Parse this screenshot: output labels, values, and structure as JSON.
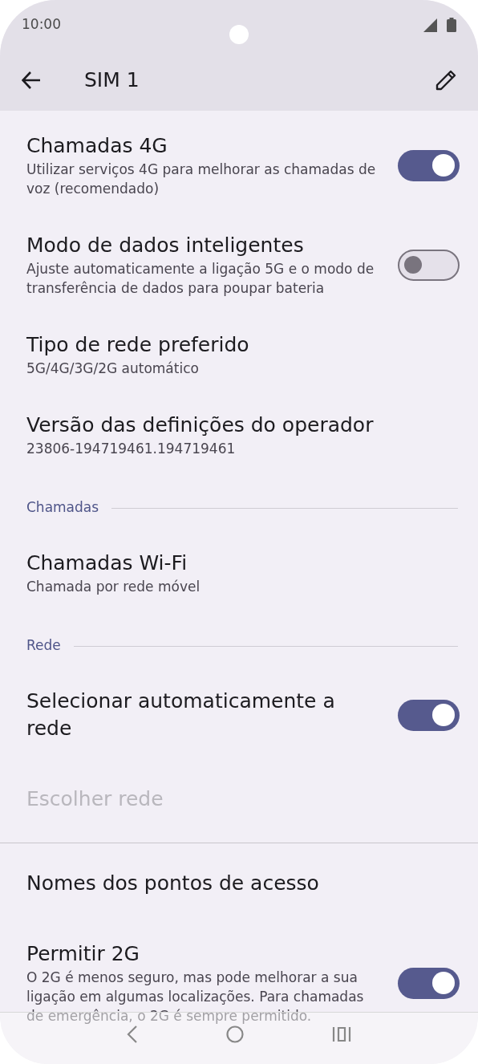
{
  "status_bar": {
    "time": "10:00"
  },
  "app_bar": {
    "title": "SIM 1"
  },
  "items": [
    {
      "kind": "setting",
      "title": "Chamadas 4G",
      "subtitle": "Utilizar serviços 4G para melhorar as chamadas de voz (recomendado)",
      "on": true,
      "disabled": false
    },
    {
      "kind": "setting",
      "title": "Modo de dados inteligentes",
      "subtitle": "Ajuste automaticamente a ligação 5G e o modo de transferência de dados para poupar bateria",
      "on": false,
      "disabled": false
    },
    {
      "kind": "setting",
      "title": "Tipo de rede preferido",
      "subtitle": "5G/4G/3G/2G automático",
      "disabled": false
    },
    {
      "kind": "setting",
      "title": "Versão das definições do operador",
      "subtitle": "23806-194719461.194719461",
      "disabled": false
    },
    {
      "kind": "section",
      "title": "Chamadas"
    },
    {
      "kind": "setting",
      "title": "Chamadas Wi-Fi",
      "subtitle": "Chamada por rede móvel",
      "disabled": false
    },
    {
      "kind": "section",
      "title": "Rede"
    },
    {
      "kind": "setting",
      "title": "Selecionar automaticamente a rede",
      "on": true,
      "disabled": false
    },
    {
      "kind": "setting",
      "title": "Escolher rede",
      "disabled": true
    },
    {
      "kind": "divider"
    },
    {
      "kind": "setting",
      "title": "Nomes dos pontos de acesso",
      "disabled": false
    },
    {
      "kind": "setting",
      "title": "Permitir 2G",
      "subtitle": "O 2G é menos seguro, mas pode melhorar a sua ligação em algumas localizações. Para chamadas de emergência, o 2G é sempre permitido.",
      "on": true,
      "disabled": false
    }
  ]
}
